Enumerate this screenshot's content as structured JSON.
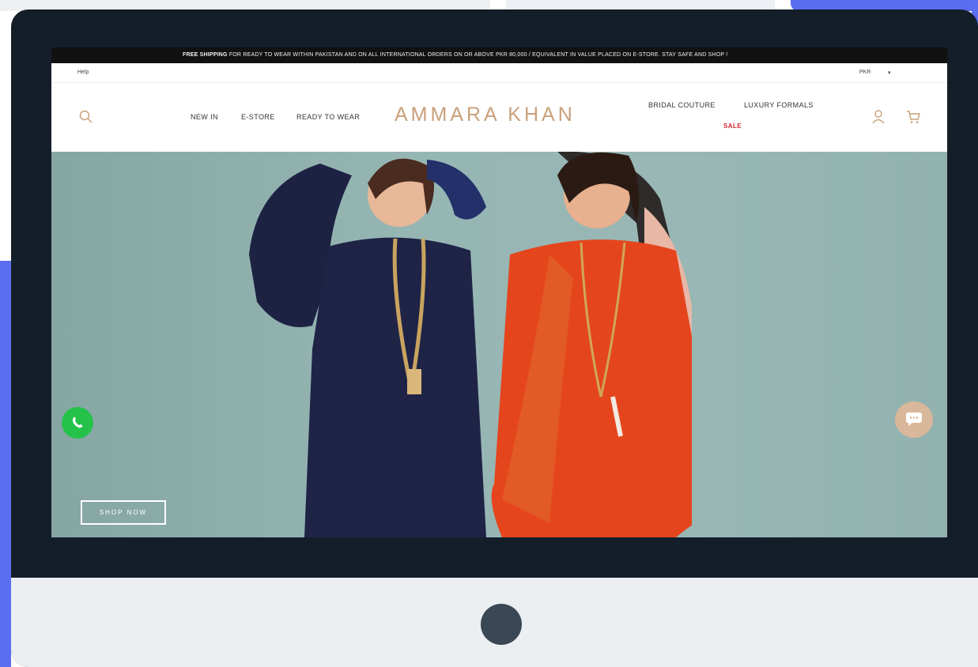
{
  "announcement": {
    "bold": "FREE SHIPPING",
    "text": " FOR READY TO WEAR WITHIN PAKISTAN AND ON ALL INTERNATIONAL ORDERS ON OR ABOVE PKR 80,000 / EQUIVALENT IN VALUE PLACED ON E-STORE. STAY SAFE AND SHOP !"
  },
  "utility": {
    "help": "Help",
    "currency": "PKR",
    "caret": "▾"
  },
  "nav": {
    "new_in": "NEW IN",
    "estore": "E-STORE",
    "ready_to_wear": "READY TO WEAR",
    "brand": "AMMARA KHAN",
    "bridal_couture": "BRIDAL COUTURE",
    "luxury_formals": "LUXURY FORMALS",
    "sale": "SALE"
  },
  "hero": {
    "cta": "SHOP NOW"
  },
  "icons": {
    "search": "search-icon",
    "user": "user-icon",
    "cart": "cart-icon",
    "whatsapp": "whatsapp-icon",
    "chat": "chat-icon"
  },
  "colors": {
    "brand": "#c9a07a",
    "sale": "#d6262c",
    "hero_bg": "#8fb0ae",
    "bezel": "#131e29",
    "accent": "#5b6ef2"
  }
}
